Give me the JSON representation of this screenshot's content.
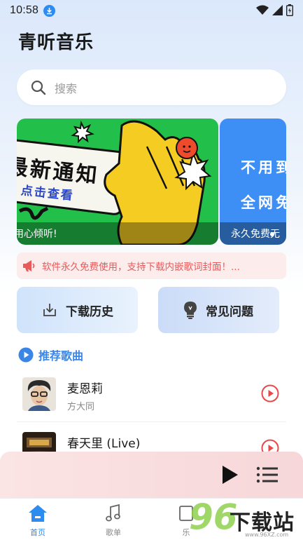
{
  "status_bar": {
    "time": "10:58",
    "icons": [
      "download-badge-icon",
      "wifi-icon",
      "signal-icon",
      "battery-icon"
    ]
  },
  "header": {
    "title": "青听音乐"
  },
  "search": {
    "placeholder": "搜索"
  },
  "banner": {
    "main": {
      "headline": "最新通知",
      "cta": "点击查看",
      "caption": "用心倾听!"
    },
    "side": {
      "line1": "不用到",
      "line2": "全网免",
      "caption": "永久免费无"
    }
  },
  "notice": {
    "text": "软件永久免费使用，支持下载内嵌歌词封面！..."
  },
  "quick_actions": [
    {
      "label": "下载历史",
      "icon": "download-tray-icon"
    },
    {
      "label": "常见问题",
      "icon": "lightbulb-icon"
    }
  ],
  "recommend": {
    "title": "推荐歌曲",
    "songs": [
      {
        "title": "麦恩莉",
        "artist": "方大同"
      },
      {
        "title": "春天里 (Live)",
        "artist": ""
      }
    ]
  },
  "player": {
    "play_icon": "play-icon",
    "list_icon": "playlist-icon"
  },
  "tabs": [
    {
      "label": "首页",
      "active": true
    },
    {
      "label": "歌单",
      "active": false
    },
    {
      "label": "乐",
      "active": false
    }
  ],
  "watermark": {
    "number": "96",
    "text": "下载站",
    "url": "www.96XZ.com"
  },
  "colors": {
    "accent": "#2d8cf0",
    "notice_red": "#e85a5a",
    "banner_green": "#22c04a",
    "banner_blue": "#3d8ef5"
  }
}
